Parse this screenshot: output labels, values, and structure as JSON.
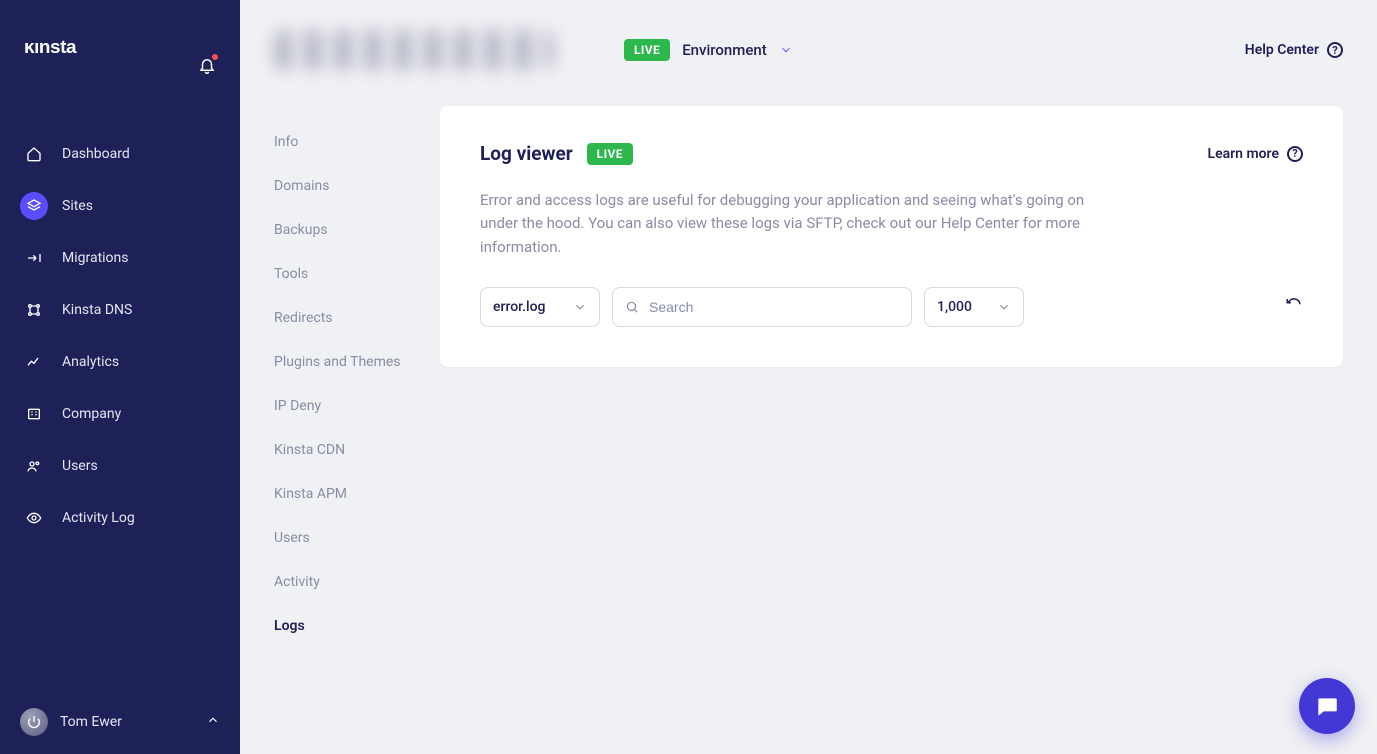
{
  "brand": "kinsta",
  "sidebar": {
    "items": [
      {
        "label": "Dashboard"
      },
      {
        "label": "Sites"
      },
      {
        "label": "Migrations"
      },
      {
        "label": "Kinsta DNS"
      },
      {
        "label": "Analytics"
      },
      {
        "label": "Company"
      },
      {
        "label": "Users"
      },
      {
        "label": "Activity Log"
      }
    ],
    "user_name": "Tom Ewer"
  },
  "secnav": {
    "items": [
      {
        "label": "Info"
      },
      {
        "label": "Domains"
      },
      {
        "label": "Backups"
      },
      {
        "label": "Tools"
      },
      {
        "label": "Redirects"
      },
      {
        "label": "Plugins and Themes"
      },
      {
        "label": "IP Deny"
      },
      {
        "label": "Kinsta CDN"
      },
      {
        "label": "Kinsta APM"
      },
      {
        "label": "Users"
      },
      {
        "label": "Activity"
      },
      {
        "label": "Logs"
      }
    ]
  },
  "header": {
    "live_badge": "LIVE",
    "env_label": "Environment",
    "help": "Help Center"
  },
  "card": {
    "title": "Log viewer",
    "live_badge": "LIVE",
    "learn": "Learn more",
    "desc": "Error and access logs are useful for debugging your application and seeing what's going on under the hood. You can also view these logs via SFTP, check out our Help Center for more information.",
    "log_select": "error.log",
    "search_placeholder": "Search",
    "count_select": "1,000"
  }
}
